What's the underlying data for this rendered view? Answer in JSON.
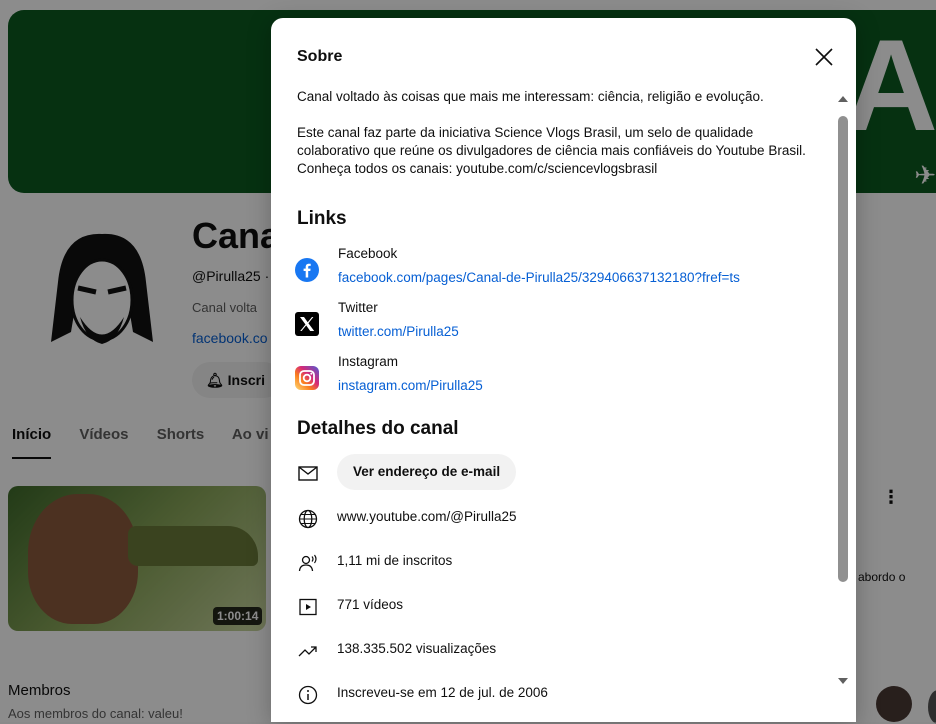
{
  "background": {
    "banner_letter": "A",
    "channel_title": "Cana",
    "channel_handle": "@Pirulla25 ·",
    "channel_desc": "Canal volta",
    "channel_link": "facebook.co",
    "subscribe_label": "Inscri",
    "tabs": [
      "Início",
      "Vídeos",
      "Shorts",
      "Ao vi"
    ],
    "video_duration": "1:00:14",
    "members_title": "Membros",
    "members_sub": "Aos membros do canal: valeu!",
    "right_snippet": "abordo o"
  },
  "dialog": {
    "title": "Sobre",
    "description": [
      "Canal voltado às coisas que mais me interessam: ciência, religião e evolução.",
      "Este canal faz parte da iniciativa Science Vlogs Brasil, um selo de qualidade colaborativo que reúne os divulgadores de ciência mais confiáveis do Youtube Brasil. Conheça todos os canais: youtube.com/c/sciencevlogsbrasil"
    ],
    "links_heading": "Links",
    "links": [
      {
        "name": "Facebook",
        "url": "facebook.com/pages/Canal-de-Pirulla25/329406637132180?fref=ts",
        "icon": "facebook-icon"
      },
      {
        "name": "Twitter",
        "url": "twitter.com/Pirulla25",
        "icon": "x-twitter-icon"
      },
      {
        "name": "Instagram",
        "url": "instagram.com/Pirulla25",
        "icon": "instagram-icon"
      }
    ],
    "details_heading": "Detalhes do canal",
    "email_button": "Ver endereço de e-mail",
    "details": {
      "url": "www.youtube.com/@Pirulla25",
      "subscribers": "1,11 mi de inscritos",
      "videos": "771 vídeos",
      "views": "138.335.502 visualizações",
      "joined": "Inscreveu-se em 12 de jul. de 2006"
    }
  },
  "colors": {
    "link": "#065fd4",
    "banner": "#0b5a1f",
    "facebook": "#1877f2"
  }
}
